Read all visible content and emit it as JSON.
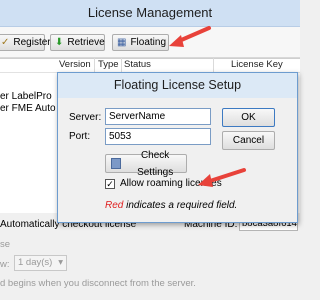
{
  "window": {
    "title": "License Management"
  },
  "toolbar": {
    "register_label": "Register",
    "retrieve_label": "Retrieve",
    "floating_label": "Floating"
  },
  "list": {
    "columns": [
      "Version",
      "Type",
      "Status",
      "License Key"
    ],
    "rows": [
      "er LabelPro",
      "er FME Auto"
    ]
  },
  "bottom": {
    "auto_checkout_label": "Automatically checkout license",
    "machine_id_label": "Machine ID:",
    "machine_id_value": "b8ca3a8f614d",
    "se_fragment": "se",
    "w_fragment": "w:",
    "duration_value": "1 day(s)",
    "footer_text": "d begins when you disconnect from the server."
  },
  "dialog": {
    "title": "Floating License Setup",
    "server_label": "Server:",
    "server_value": "ServerName",
    "port_label": "Port:",
    "port_value": "5053",
    "ok_label": "OK",
    "cancel_label": "Cancel",
    "check_settings_label": "Check Settings",
    "roaming_label": "Allow roaming licenses",
    "roaming_checked": true,
    "required_red": "Red",
    "required_rest": " indicates a required field."
  },
  "colors": {
    "arrow": "#e8423a",
    "accent": "#3d7ac2",
    "required": "#e02020"
  }
}
